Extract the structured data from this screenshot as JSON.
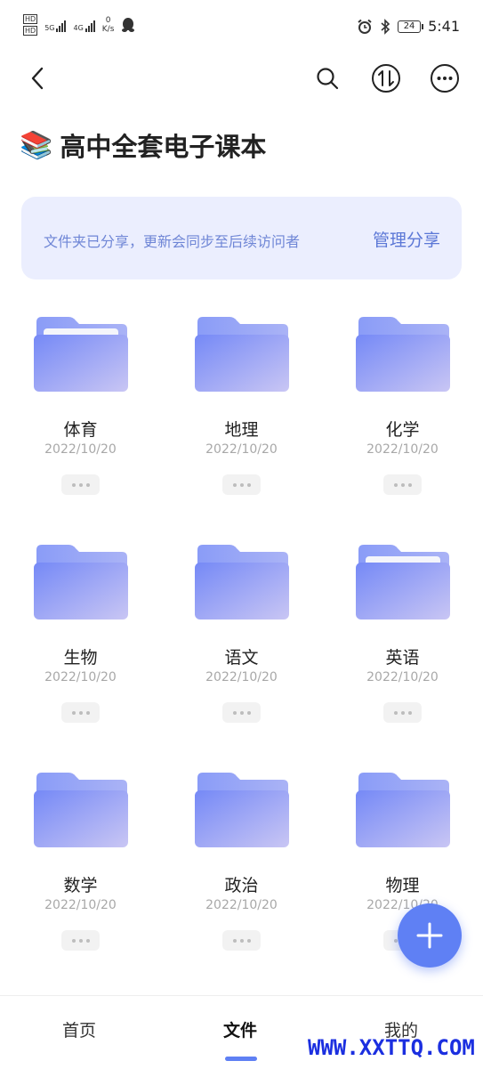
{
  "status_bar": {
    "sim1_label": "HD",
    "sim2_label": "HD",
    "net1": "5G",
    "net2": "4G",
    "speed_value": "0",
    "speed_unit": "K/s",
    "battery": "24",
    "time": "5:41"
  },
  "header": {
    "title_emoji": "📚",
    "title": "高中全套电子课本"
  },
  "share_banner": {
    "text": "文件夹已分享，更新会同步至后续访问者",
    "action": "管理分享"
  },
  "folders": [
    {
      "name": "体育",
      "date": "2022/10/20",
      "has_content": true
    },
    {
      "name": "地理",
      "date": "2022/10/20",
      "has_content": false
    },
    {
      "name": "化学",
      "date": "2022/10/20",
      "has_content": false
    },
    {
      "name": "生物",
      "date": "2022/10/20",
      "has_content": false
    },
    {
      "name": "语文",
      "date": "2022/10/20",
      "has_content": false
    },
    {
      "name": "英语",
      "date": "2022/10/20",
      "has_content": true
    },
    {
      "name": "数学",
      "date": "2022/10/20",
      "has_content": false
    },
    {
      "name": "政治",
      "date": "2022/10/20",
      "has_content": false
    },
    {
      "name": "物理",
      "date": "2022/10/20",
      "has_content": false
    }
  ],
  "bottom_nav": {
    "items": [
      {
        "label": "首页",
        "active": false
      },
      {
        "label": "文件",
        "active": true
      },
      {
        "label": "我的",
        "active": false
      }
    ]
  },
  "watermark": "WWW.XXTTQ.COM",
  "colors": {
    "accent": "#5f80f4",
    "banner_bg": "#ebeefe",
    "banner_text": "#6f86d6",
    "folder": "#8596f5",
    "watermark": "#1b2fe0"
  }
}
